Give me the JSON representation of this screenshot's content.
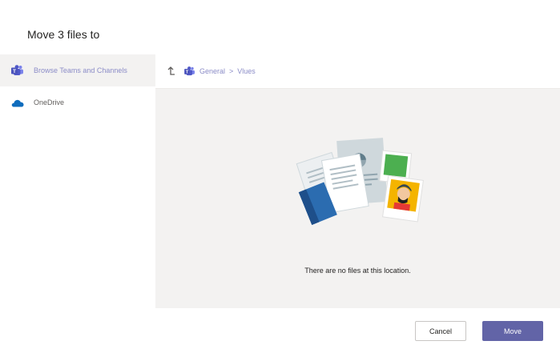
{
  "dialog": {
    "title": "Move 3 files to"
  },
  "sidebar": {
    "items": [
      {
        "label": "Browse Teams and Channels",
        "icon": "teams-icon",
        "selected": true
      },
      {
        "label": "OneDrive",
        "icon": "onedrive-icon",
        "selected": false
      }
    ]
  },
  "breadcrumb": {
    "up_icon": "up-arrow-icon",
    "team_icon": "teams-icon",
    "crumbs": [
      "General",
      "Vlues"
    ],
    "separator": ">"
  },
  "content": {
    "empty_message": "There are no files at this location.",
    "illustration": "empty-files-illustration"
  },
  "footer": {
    "cancel_label": "Cancel",
    "move_label": "Move"
  },
  "colors": {
    "accent": "#6264a7",
    "accent_light": "#8b8cc7",
    "panel_bg": "#f3f2f1",
    "onedrive": "#0f6cbd"
  }
}
